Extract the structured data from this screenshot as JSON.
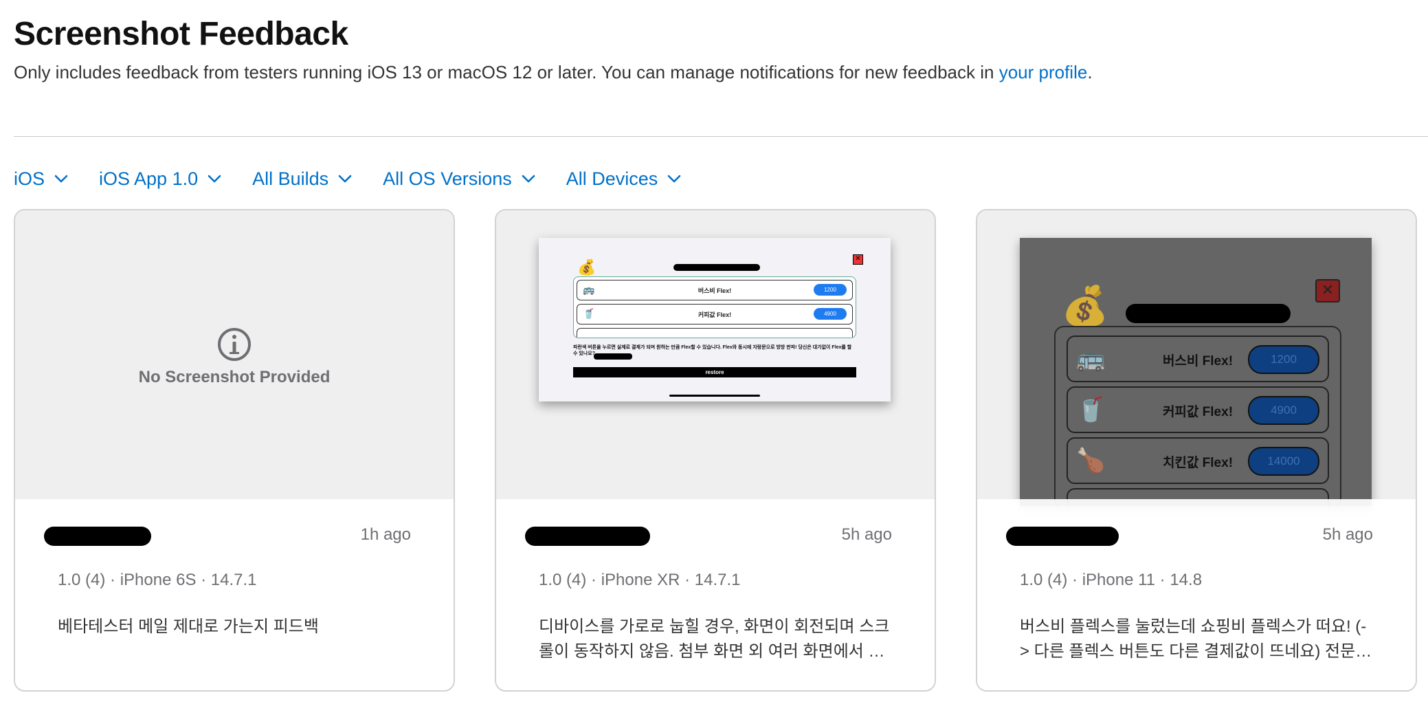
{
  "page": {
    "title": "Screenshot Feedback",
    "subtitle_text": "Only includes feedback from testers running iOS 13 or macOS 12 or later. You can manage notifications for new feedback in ",
    "subtitle_link": "your profile",
    "subtitle_end": "."
  },
  "filters": [
    {
      "label": "iOS"
    },
    {
      "label": "iOS App 1.0"
    },
    {
      "label": "All Builds"
    },
    {
      "label": "All OS Versions"
    },
    {
      "label": "All Devices"
    }
  ],
  "cards": [
    {
      "no_screenshot_text": "No Screenshot Provided",
      "time": "1h ago",
      "device": "1.0 (4) · iPhone 6S · 14.7.1",
      "comment": "베타테스터 메일 제대로 가는지 피드백"
    },
    {
      "time": "5h ago",
      "device": "1.0 (4) · iPhone XR · 14.7.1",
      "comment": "디바이스를 가로로 눕힐 경우, 화면이 회전되며 스크롤이 동작하지 않음. 첨부 화면 외 여러 화면에서 가로모드 대응이 필요합니다.",
      "thumb": {
        "rows": [
          {
            "label": "버스비 Flex!",
            "price": "1200",
            "icon": "🚌"
          },
          {
            "label": "커피값 Flex!",
            "price": "4900",
            "icon": "🥤"
          }
        ],
        "desc": "파란색 버튼을 누르면 실제로 결제가 되며 원하는 만큼 Flex할 수 있습니다. Flex와 동시에 자랑문으로 방방 판파! 당신은 대가없이 Flex를 할 수 있나요?",
        "restore": "restore",
        "close": "✕",
        "bag": "💰"
      }
    },
    {
      "time": "5h ago",
      "device": "1.0 (4) · iPhone 11 · 14.8",
      "comment": "버스비 플렉스를 눌렀는데 쇼핑비 플렉스가 떠요! (-> 다른 플렉스 버튼도 다른 결제값이 뜨네요) 전문가부탁드립니다.",
      "thumb": {
        "rows": [
          {
            "label": "버스비 Flex!",
            "price": "1200",
            "icon": "🚌"
          },
          {
            "label": "커피값 Flex!",
            "price": "4900",
            "icon": "🥤"
          },
          {
            "label": "치킨값 Flex!",
            "price": "14000",
            "icon": "🍗"
          }
        ],
        "close": "✕",
        "bag": "💰"
      }
    }
  ]
}
